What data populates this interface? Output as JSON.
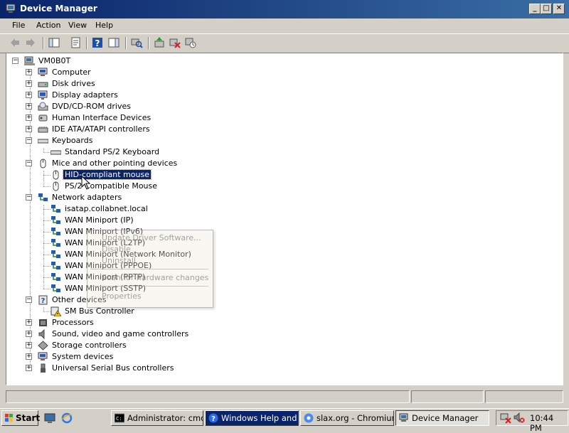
{
  "window": {
    "title": "Device Manager",
    "buttons": {
      "minimize": "_",
      "maximize": "□",
      "close": "✕"
    }
  },
  "menu": [
    "File",
    "Action",
    "View",
    "Help"
  ],
  "tree": {
    "root": "VM0B0T",
    "categories": [
      "Computer",
      "Disk drives",
      "Display adapters",
      "DVD/CD-ROM drives",
      "Human Interface Devices",
      "IDE ATA/ATAPI controllers"
    ],
    "keyboards": {
      "label": "Keyboards",
      "children": [
        "Standard PS/2 Keyboard"
      ]
    },
    "mice": {
      "label": "Mice and other pointing devices",
      "children": [
        "HID-compliant mouse",
        "PS/2 Compatible Mouse"
      ]
    },
    "network": {
      "label": "Network adapters",
      "children": [
        "isatap.collabnet.local",
        "WAN Miniport (IP)",
        "WAN Miniport (IPv6)",
        "WAN Miniport (L2TP)",
        "WAN Miniport (Network Monitor)",
        "WAN Miniport (PPPOE)",
        "WAN Miniport (PPTP)",
        "WAN Miniport (SSTP)"
      ]
    },
    "other": {
      "label": "Other devices",
      "children": [
        "SM Bus Controller"
      ]
    },
    "rest": [
      "Processors",
      "Sound, video and game controllers",
      "Storage controllers",
      "System devices",
      "Universal Serial Bus controllers"
    ]
  },
  "context_menu": [
    "Update Driver Software...",
    "Disable",
    "Uninstall",
    "Scan for hardware changes",
    "Properties"
  ],
  "taskbar": {
    "start": "Start",
    "tasks": [
      "Administrator: cmd...",
      "Windows Help and ...",
      "slax.org - Chromium",
      "Device Manager"
    ],
    "clock": "10:44 PM"
  },
  "colors": {
    "title_start": "#0a246a",
    "title_end": "#3a6ea5",
    "selection": "#0a246a"
  }
}
